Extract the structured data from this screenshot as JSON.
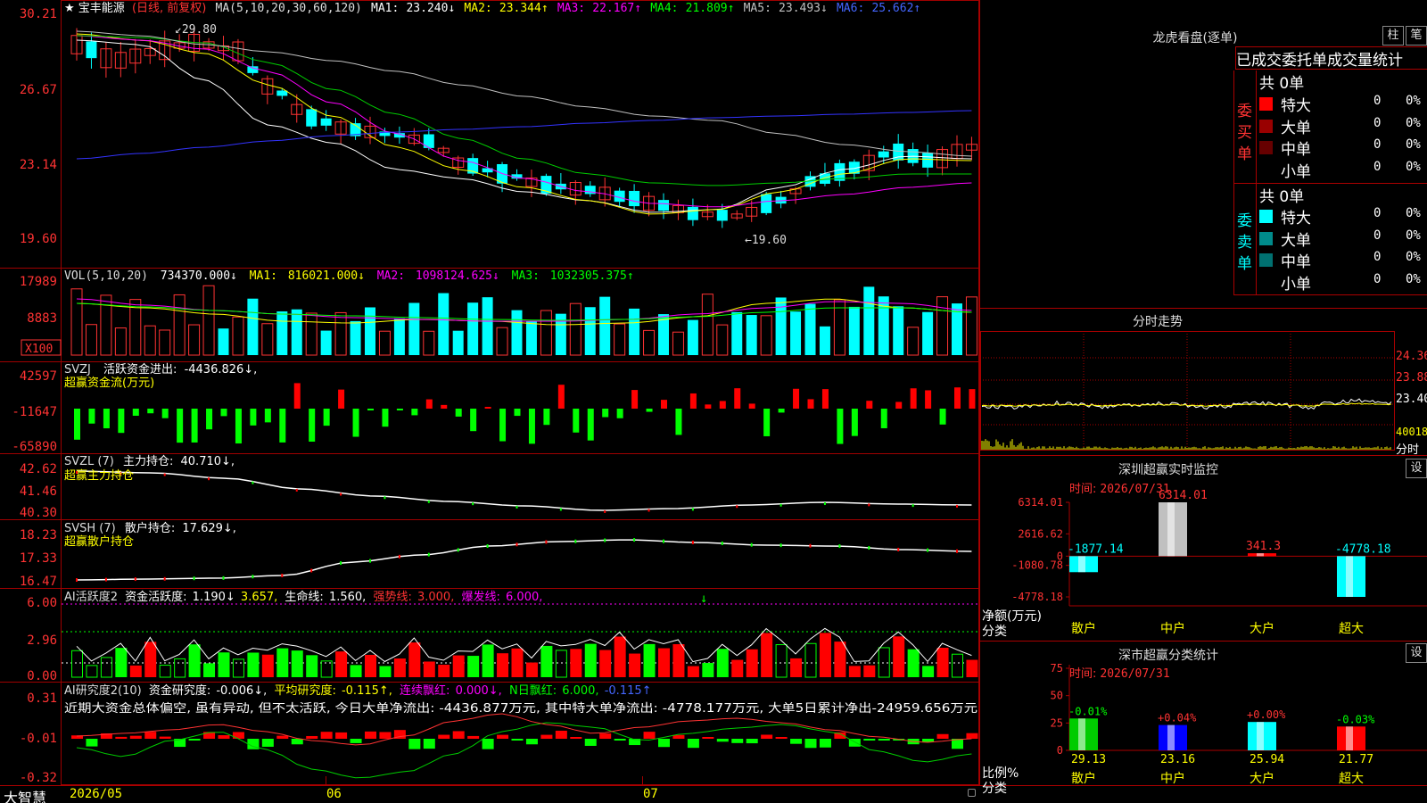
{
  "stock": {
    "star": "★",
    "name": "宝丰能源",
    "mode": "(日线, 前复权)"
  },
  "price_panel": {
    "ma_header": "MA(5,10,20,30,60,120)",
    "ma": [
      {
        "label": "MA1:",
        "value": "23.240↓",
        "color": "#ffffff"
      },
      {
        "label": "MA2:",
        "value": "23.344↑",
        "color": "#ffff00"
      },
      {
        "label": "MA3:",
        "value": "22.167↑",
        "color": "#ff00ff"
      },
      {
        "label": "MA4:",
        "value": "21.809↑",
        "color": "#00ff00"
      },
      {
        "label": "MA5:",
        "value": "23.493↓",
        "color": "#c0c0c0"
      },
      {
        "label": "MA6:",
        "value": "25.662↑",
        "color": "#0000ff"
      }
    ],
    "y_ticks": [
      "30.21",
      "26.67",
      "23.14",
      "19.60"
    ],
    "high_label": "29.80",
    "low_label": "19.60",
    "high_arrow": "↙",
    "low_arrow": "←"
  },
  "vol_panel": {
    "header": "VOL(5,10,20)",
    "vol": "734370.000↓",
    "ma1": {
      "label": "MA1:",
      "value": "816021.000↓"
    },
    "ma2": {
      "label": "MA2:",
      "value": "1098124.625↓"
    },
    "ma3": {
      "label": "MA3:",
      "value": "1032305.375↑"
    },
    "y_ticks": [
      "17989",
      "8883"
    ],
    "unit": "X100"
  },
  "svzj_panel": {
    "header": "SVZJ",
    "label": "活跃资金进出:",
    "value": "-4436.826↓,",
    "subtitle": "超赢资金流(万元)",
    "y_ticks": [
      "42597",
      "-11647",
      "-65890"
    ]
  },
  "svzl_panel": {
    "header": "SVZL (7)",
    "label": "主力持仓:",
    "value": "40.710↓,",
    "subtitle": "超赢主力持仓",
    "y_ticks": [
      "42.62",
      "41.46",
      "40.30"
    ]
  },
  "svsh_panel": {
    "header": "SVSH (7)",
    "label": "散户持仓:",
    "value": "17.629↓,",
    "subtitle": "超赢散户持仓",
    "y_ticks": [
      "18.23",
      "17.33",
      "16.47"
    ]
  },
  "ai1_panel": {
    "header": "AI活跃度2",
    "label1": "资金活跃度:",
    "value1": "1.190↓",
    "value2": "3.657,",
    "label3": "生命线:",
    "value3": "1.560,",
    "label4": "强势线:",
    "value4": "3.000,",
    "label5": "爆发线:",
    "value5": "6.000,",
    "y_ticks": [
      "6.00",
      "2.96",
      "0.00"
    ]
  },
  "ai2_panel": {
    "header": "AI研究度2(10)",
    "label1": "资金研究度:",
    "value1": "-0.006↓,",
    "label2": "平均研究度:",
    "value2": "-0.115↑,",
    "label3": "连续飘红:",
    "value3": "0.000↓,",
    "label4": "N日飘红:",
    "value4": "6.000,",
    "value5": "-0.115↑",
    "comment": "近期大资金总体偏空, 虽有异动, 但不太活跃, 今日大单净流出: -4436.877万元, 其中特大单净流出: -4778.177万元, 大单5日累计净出-24959.656万元",
    "y_ticks": [
      "0.31",
      "-0.01",
      "-0.32"
    ]
  },
  "status": {
    "app": "大智慧",
    "dates": [
      "2026/05",
      "06",
      "07"
    ]
  },
  "dragon": {
    "title": "龙虎看盘(逐单)",
    "btn_zhu": "柱",
    "btn_bi": "笔",
    "tab_done": "已成交",
    "tab_order": "委托单",
    "tab_stats": "成交量统计",
    "buy": {
      "side_label": "委买单",
      "total": "共 0单",
      "rows": [
        {
          "name": "特大",
          "count": "0",
          "pct": "0%",
          "color": "#ff0000"
        },
        {
          "name": "大单",
          "count": "0",
          "pct": "0%",
          "color": "#990000"
        },
        {
          "name": "中单",
          "count": "0",
          "pct": "0%",
          "color": "#660000"
        },
        {
          "name": "小单",
          "count": "0",
          "pct": "0%",
          "color": ""
        }
      ]
    },
    "sell": {
      "side_label": "委卖单",
      "total": "共 0单",
      "rows": [
        {
          "name": "特大",
          "count": "0",
          "pct": "0%",
          "color": "#00ffff"
        },
        {
          "name": "大单",
          "count": "0",
          "pct": "0%",
          "color": "#008b8b"
        },
        {
          "name": "中单",
          "count": "0",
          "pct": "0%",
          "color": "#007070"
        },
        {
          "name": "小单",
          "count": "0",
          "pct": "0%",
          "color": ""
        }
      ]
    }
  },
  "intraday": {
    "title": "分时走势",
    "prices": [
      "24.36",
      "23.88",
      "23.40"
    ],
    "vol_label": "40018",
    "time_label": "分时"
  },
  "monitor": {
    "title": "深圳超赢实时监控",
    "btn": "设",
    "time_label": "时间:",
    "time": "2026/07/31",
    "y_ticks": [
      "6314.01",
      "2616.62",
      "0",
      "-1080.78",
      "-4778.18"
    ],
    "side_label1": "净额(万元)",
    "side_label2": "分类"
  },
  "classify": {
    "title": "深市超赢分类统计",
    "btn": "设",
    "time_label": "时间:",
    "time": "2026/07/31",
    "y_ticks": [
      "75",
      "50",
      "25",
      "0"
    ],
    "side_label1": "比例%",
    "side_label2": "分类"
  },
  "chart_data": [
    {
      "type": "bar",
      "title": "深圳超赢实时监控",
      "categories": [
        "散户",
        "中户",
        "大户",
        "超大"
      ],
      "values": [
        -1877.14,
        6314.01,
        341.3,
        -4778.18
      ],
      "data_labels": [
        "-1877.14",
        "6314.01",
        "341.3",
        "-4778.18"
      ],
      "ylim": [
        -4778.18,
        6314.01
      ],
      "ylabel": "净额(万元)",
      "xlabel": "分类",
      "colors": [
        "#00ffff",
        "#c0c0c0",
        "#ff0000",
        "#00ffff"
      ]
    },
    {
      "type": "bar",
      "title": "深市超赢分类统计",
      "categories": [
        "散户",
        "中户",
        "大户",
        "超大"
      ],
      "values": [
        29.13,
        23.16,
        25.94,
        21.77
      ],
      "changes": [
        "-0.01%",
        "+0.04%",
        "+0.00%",
        "-0.03%"
      ],
      "data_labels": [
        "29.13",
        "23.16",
        "25.94",
        "21.77"
      ],
      "ylim": [
        0,
        75
      ],
      "ylabel": "比例%",
      "xlabel": "分类",
      "colors": [
        "#00cc00",
        "#0000ff",
        "#00ffff",
        "#ff0000"
      ]
    }
  ]
}
